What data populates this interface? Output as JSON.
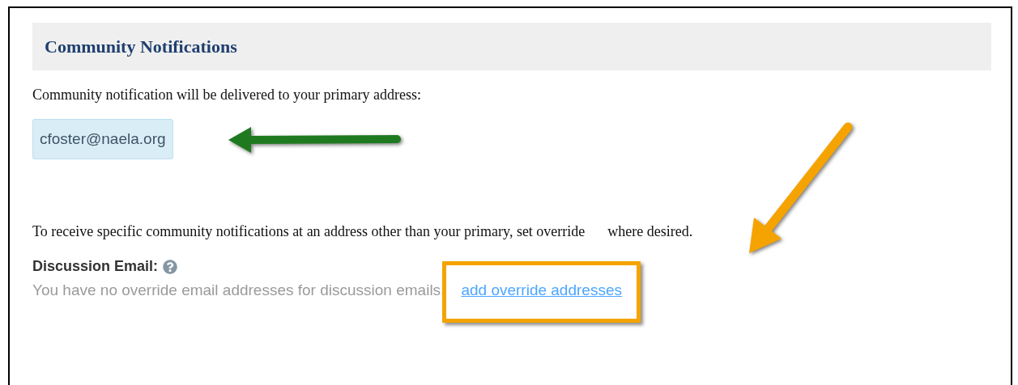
{
  "section": {
    "title": "Community Notifications"
  },
  "primary": {
    "intro": "Community notification will be delivered to your primary address:",
    "email": "cfoster@naela.org"
  },
  "override_intro": [
    "To receive specific community notifications at an address other than your primary, set override",
    "where desired."
  ],
  "discussion": {
    "label": "Discussion Email:",
    "note": "You have no override email addresses for discussion emails.",
    "link": "add override addresses"
  },
  "annotations": [
    {
      "kind": "arrow",
      "color": "#1f7a1f"
    },
    {
      "kind": "arrow",
      "color": "#f5a300"
    },
    {
      "kind": "frame",
      "color": "#f5a300"
    }
  ]
}
